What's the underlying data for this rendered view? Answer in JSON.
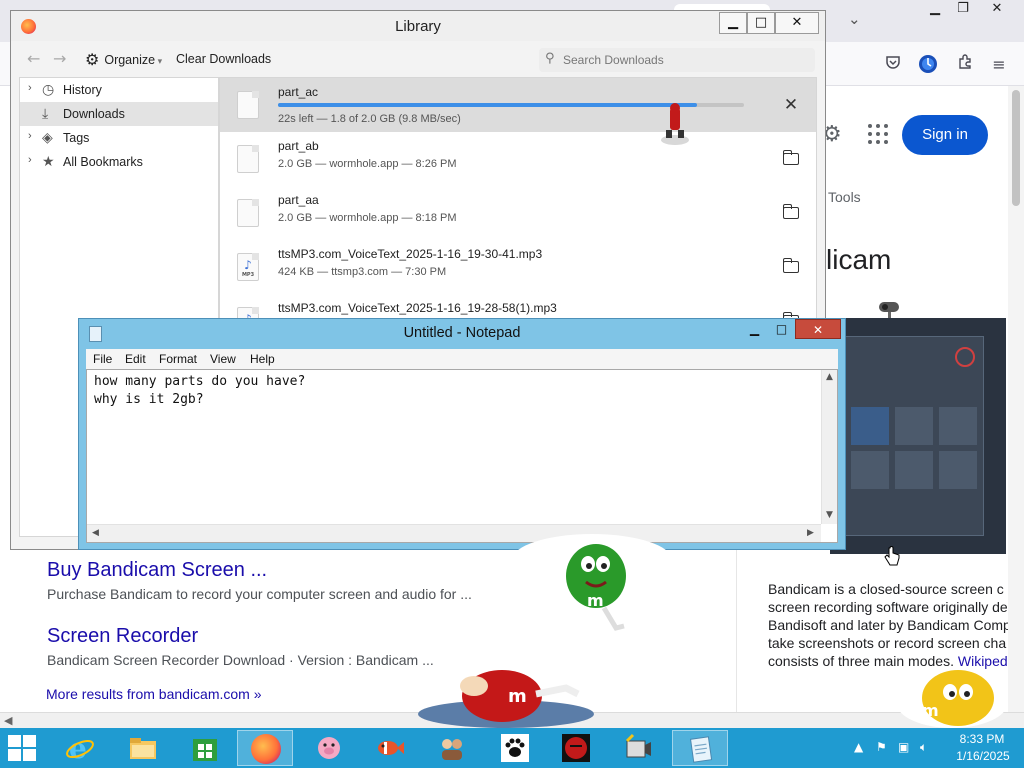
{
  "browser": {
    "sign_in_label": "Sign in",
    "tools_label": "Tools",
    "knowledge_panel": {
      "title_fragment": "licam",
      "description_lines": [
        "Bandicam is a closed-source screen c",
        "screen recording software originally de",
        "Bandisoft and later by Bandicam Comp",
        "take screenshots or record screen cha",
        "consists of three main modes."
      ],
      "wiki_link": "Wikiped"
    },
    "results": [
      {
        "title": "Buy Bandicam Screen ...",
        "snippet": "Purchase Bandicam to record your computer screen and audio for ..."
      },
      {
        "title": "Screen Recorder",
        "snippet": "Bandicam Screen Recorder Download · Version : Bandicam ..."
      }
    ],
    "more_results": "More results from bandicam.com »"
  },
  "library": {
    "title": "Library",
    "toolbar": {
      "organize_label": "Organize",
      "clear_label": "Clear Downloads",
      "search_placeholder": "Search Downloads"
    },
    "sidebar": [
      {
        "label": "History",
        "icon": "clock-icon",
        "expandable": true
      },
      {
        "label": "Downloads",
        "icon": "download-icon",
        "expandable": false,
        "selected": true
      },
      {
        "label": "Tags",
        "icon": "tag-icon",
        "expandable": true
      },
      {
        "label": "All Bookmarks",
        "icon": "star-icon",
        "expandable": true
      }
    ],
    "downloads": [
      {
        "name": "part_ac",
        "status": "22s left — 1.8 of 2.0 GB (9.8 MB/sec)",
        "progress": 0.9,
        "active": true,
        "type": "file"
      },
      {
        "name": "part_ab",
        "status": "2.0 GB — wormhole.app — 8:26 PM",
        "type": "file"
      },
      {
        "name": "part_aa",
        "status": "2.0 GB — wormhole.app — 8:18 PM",
        "type": "file"
      },
      {
        "name": "ttsMP3.com_VoiceText_2025-1-16_19-30-41.mp3",
        "status": "424 KB — ttsmp3.com — 7:30 PM",
        "type": "mp3"
      },
      {
        "name": "ttsMP3.com_VoiceText_2025-1-16_19-28-58(1).mp3",
        "status": "",
        "type": "mp3"
      }
    ],
    "mp3_tag": "MP3"
  },
  "notepad": {
    "title": "Untitled - Notepad",
    "menu": [
      "File",
      "Edit",
      "Format",
      "View",
      "Help"
    ],
    "text": "how many parts do you have?\nwhy is it 2gb?"
  },
  "taskbar": {
    "apps": [
      "internet-explorer",
      "file-explorer",
      "windows-store",
      "firefox",
      "pig-app",
      "fish-app",
      "people-app",
      "paw-app",
      "red-app",
      "camera-app",
      "notepad-app"
    ],
    "time": "8:33 PM",
    "date": "1/16/2025"
  },
  "colors": {
    "taskbar": "#1f9bd1",
    "sign_in": "#0b57d0",
    "link": "#1a0dab",
    "progress": "#3d8fe8",
    "notepad_frame": "#7fc4e6"
  }
}
